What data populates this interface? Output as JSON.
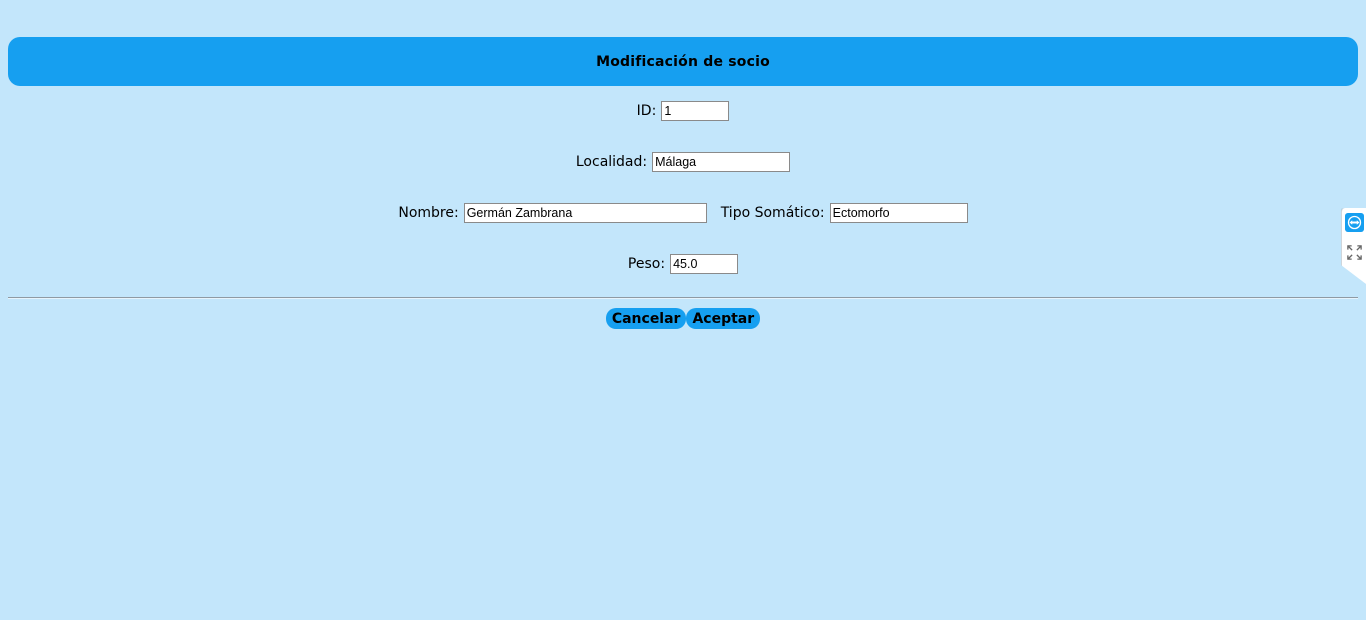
{
  "header": {
    "title": "Modificación de socio"
  },
  "form": {
    "id": {
      "label": "ID:",
      "value": "1"
    },
    "localidad": {
      "label": "Localidad:",
      "value": "Málaga"
    },
    "nombre": {
      "label": "Nombre:",
      "value": "Germán Zambrana"
    },
    "tipo_somatico": {
      "label": "Tipo Somático:",
      "value": "Ectomorfo"
    },
    "peso": {
      "label": "Peso:",
      "value": "45.0"
    }
  },
  "actions": {
    "cancel_label": "Cancelar",
    "accept_label": "Aceptar"
  },
  "side_widget": {
    "icons": [
      "teamviewer-icon",
      "expand-icon"
    ],
    "accent": "#169ff0"
  },
  "colors": {
    "background": "#c3e6fb",
    "accent": "#169ff0"
  }
}
